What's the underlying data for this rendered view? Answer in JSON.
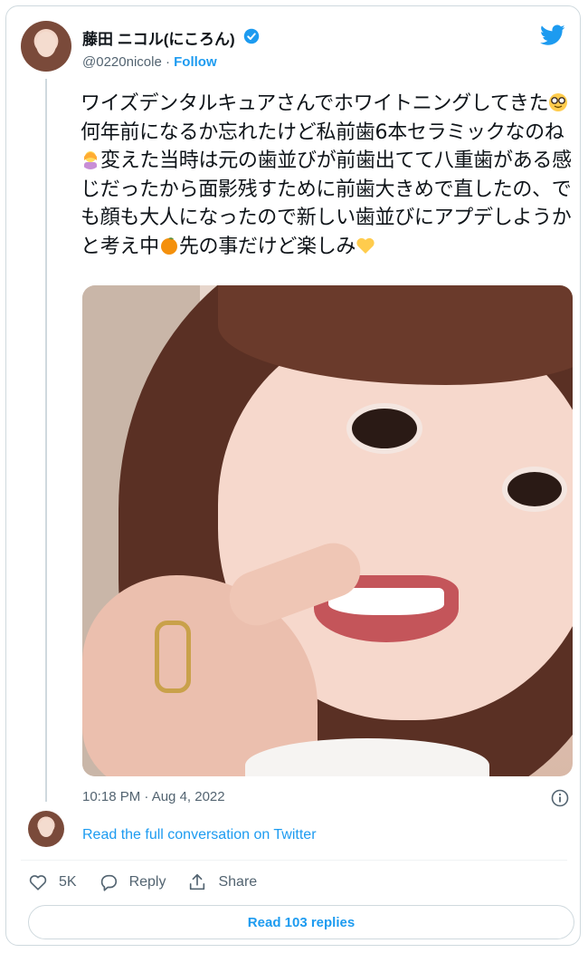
{
  "author": {
    "display_name": "藤田 ニコル(にころん)",
    "handle": "@0220nicole",
    "separator": " · ",
    "follow_label": "Follow"
  },
  "tweet": {
    "text_part1": "ワイズデンタルキュアさんでホワイトニングしてきた",
    "text_part2": "何年前になるか忘れたけど私前歯6本セラミックなのね",
    "text_part3": "変えた当時は元の歯並びが前歯出てて八重歯がある感じだったから面影残すために前歯大きめで直したの、でも顔も大人になったので新しい歯並びにアプデしようかと考え中",
    "text_part4": "先の事だけど楽しみ",
    "timestamp": "10:18 PM · Aug 4, 2022"
  },
  "footer": {
    "read_conversation": "Read the full conversation on Twitter",
    "like_count": "5K",
    "reply_label": "Reply",
    "share_label": "Share",
    "read_replies": "Read 103 replies"
  },
  "colors": {
    "accent": "#1d9bf0",
    "text": "#0f1419",
    "muted": "#536471",
    "border": "#cfd9de"
  },
  "icons": [
    "verified-badge-icon",
    "twitter-logo-icon",
    "nerd-face-emoji",
    "woman-tipping-hand-emoji",
    "tangerine-emoji",
    "yellow-heart-emoji",
    "info-icon",
    "heart-icon",
    "reply-icon",
    "share-icon"
  ]
}
